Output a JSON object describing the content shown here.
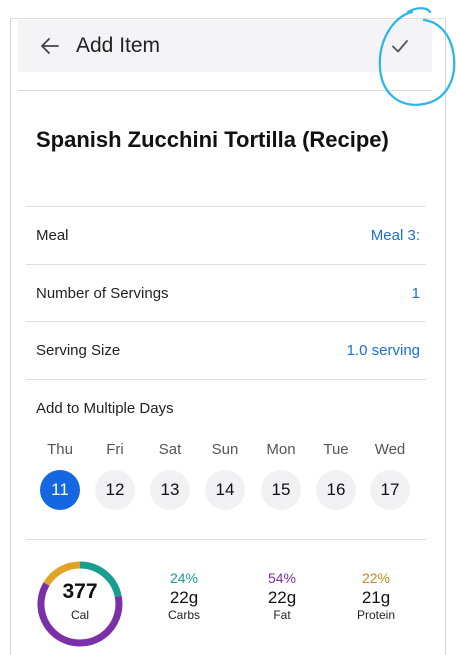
{
  "header": {
    "title": "Add Item"
  },
  "item": {
    "name": "Spanish Zucchini Tortilla (Recipe)"
  },
  "fields": [
    {
      "label": "Meal",
      "value": "Meal 3:"
    },
    {
      "label": "Number of Servings",
      "value": "1"
    },
    {
      "label": "Serving Size",
      "value": "1.0 serving"
    }
  ],
  "days": {
    "title": "Add to Multiple Days",
    "list": [
      {
        "name": "Thu",
        "num": "11",
        "selected": true
      },
      {
        "name": "Fri",
        "num": "12",
        "selected": false
      },
      {
        "name": "Sat",
        "num": "13",
        "selected": false
      },
      {
        "name": "Sun",
        "num": "14",
        "selected": false
      },
      {
        "name": "Mon",
        "num": "15",
        "selected": false
      },
      {
        "name": "Tue",
        "num": "16",
        "selected": false
      },
      {
        "name": "Wed",
        "num": "17",
        "selected": false
      }
    ]
  },
  "nutrition": {
    "calories": "377",
    "cal_label": "Cal",
    "macros": [
      {
        "pct": "24%",
        "grams": "22g",
        "label": "Carbs",
        "color": "#1a9e8f"
      },
      {
        "pct": "54%",
        "grams": "22g",
        "label": "Fat",
        "color": "#7b2fa8"
      },
      {
        "pct": "22%",
        "grams": "21g",
        "label": "Protein",
        "color": "#c78a1e"
      }
    ]
  },
  "colors": {
    "accent": "#1b6fd6",
    "selected_day": "#1467e0",
    "annotation": "#2bb5e8"
  },
  "icons": {
    "back": "arrow-left-icon",
    "confirm": "check-icon"
  }
}
